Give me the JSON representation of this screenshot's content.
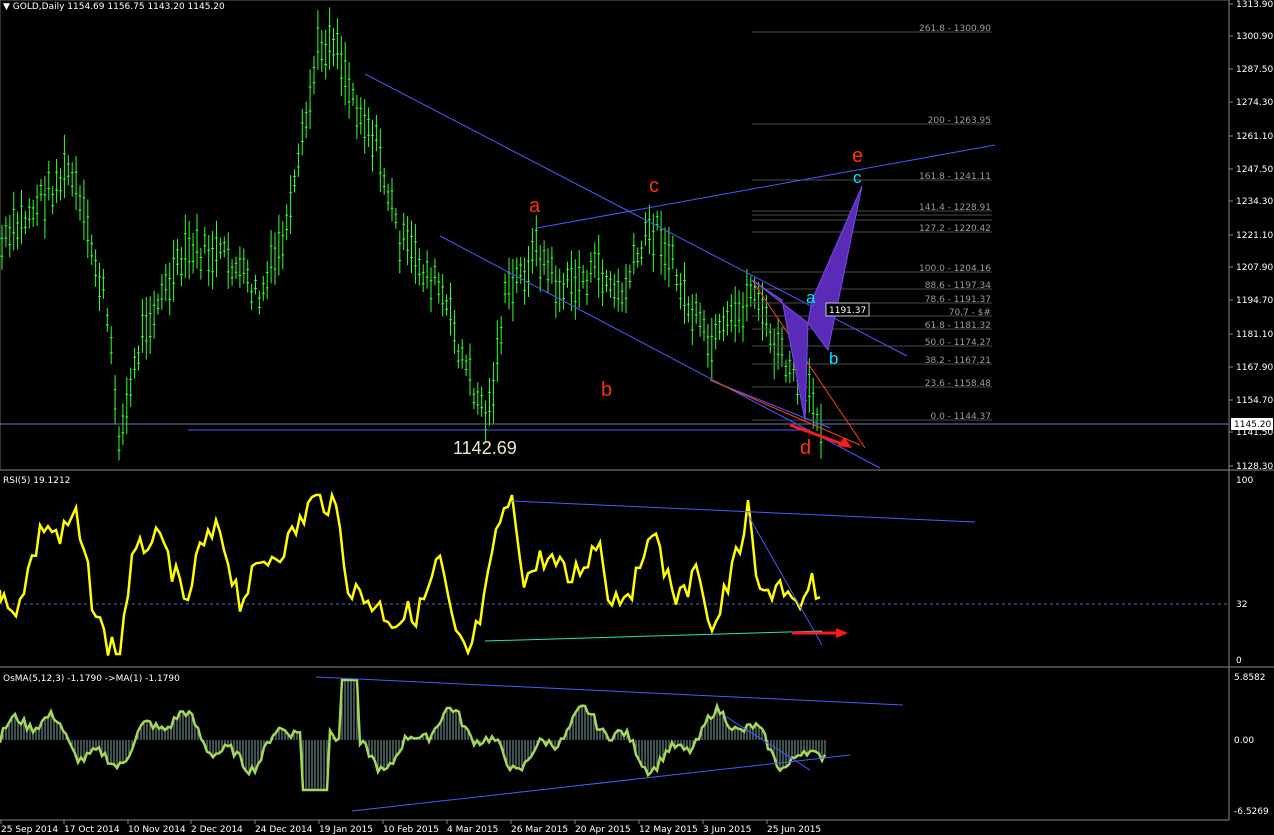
{
  "main_title": "GOLD,Daily  1154.69 1156.75 1143.20 1145.20",
  "rsi_title": "RSI(5) 19.1212",
  "osma_title": "OsMA(5,12,3) -1.1790  ->MA(1) -1.1790",
  "price_axis": [
    "1313.90",
    "1300.90",
    "1287.50",
    "1274.30",
    "1261.10",
    "1247.50",
    "1234.30",
    "1221.10",
    "1207.90",
    "1194.70",
    "1181.10",
    "1167.90",
    "1154.70",
    "1141.50",
    "1128.30"
  ],
  "current_price": "1145.20",
  "rsi_axis": [
    "100",
    "32",
    "0"
  ],
  "osma_axis": [
    "5.8582",
    "0.00",
    "-6.5269"
  ],
  "dates": [
    "25 Sep 2014",
    "17 Oct 2014",
    "10 Nov 2014",
    "2 Dec 2014",
    "24 Dec 2014",
    "19 Jan 2015",
    "10 Feb 2015",
    "4 Mar 2015",
    "26 Mar 2015",
    "20 Apr 2015",
    "12 May 2015",
    "3 Jun 2015",
    "25 Jun 2015"
  ],
  "fib_levels": [
    {
      "label": "261.8 - 1300.90"
    },
    {
      "label": "200 - 1263.95"
    },
    {
      "label": "161.8 - 1241.11"
    },
    {
      "label": "141.4 - 1228.91"
    },
    {
      "label": "127.2 - 1220.42"
    },
    {
      "label": "100.0 - 1204.16"
    },
    {
      "label": "88.6 - 1197.34"
    },
    {
      "label": "78.6 - 1191.37"
    },
    {
      "label": "70.7 - $#"
    },
    {
      "label": "61.8 - 1181.32"
    },
    {
      "label": "50.0 - 1174.27"
    },
    {
      "label": "38.2 - 1167.21"
    },
    {
      "label": "23.6 - 1158.48"
    },
    {
      "label": "0.0 - 1144.37"
    }
  ],
  "price_box": "1191.37",
  "low_label": "1142.69",
  "waves_red": [
    "a",
    "c",
    "b",
    "d",
    "e"
  ],
  "waves_cyan": [
    "a",
    "b",
    "c"
  ],
  "colors": {
    "candle": "#33ff33",
    "rsi": "#ffff00",
    "trend": "#4a5aff",
    "wave_red": "#ff3300",
    "wave_cyan": "#00e5ff",
    "pattern": "#5a2ab8"
  }
}
